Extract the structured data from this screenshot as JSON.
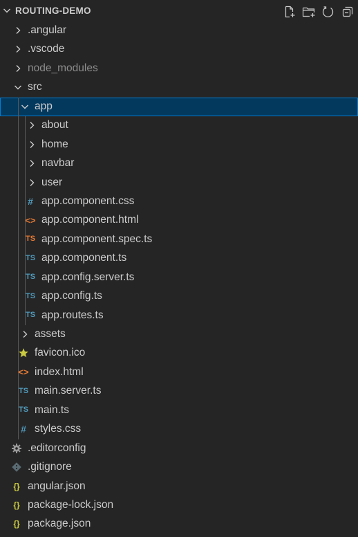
{
  "explorer": {
    "title": "ROUTING-DEMO",
    "actions": [
      {
        "name": "new-file",
        "icon": "new-file-icon"
      },
      {
        "name": "new-folder",
        "icon": "new-folder-icon"
      },
      {
        "name": "refresh",
        "icon": "refresh-icon"
      },
      {
        "name": "collapse-all",
        "icon": "collapse-all-icon"
      }
    ]
  },
  "tree": [
    {
      "label": ".angular",
      "depth": 0,
      "kind": "folder",
      "expanded": false
    },
    {
      "label": ".vscode",
      "depth": 0,
      "kind": "folder",
      "expanded": false
    },
    {
      "label": "node_modules",
      "depth": 0,
      "kind": "folder",
      "expanded": false,
      "dim": true
    },
    {
      "label": "src",
      "depth": 0,
      "kind": "folder",
      "expanded": true
    },
    {
      "label": "app",
      "depth": 1,
      "kind": "folder",
      "expanded": true,
      "selected": true
    },
    {
      "label": "about",
      "depth": 2,
      "kind": "folder",
      "expanded": false
    },
    {
      "label": "home",
      "depth": 2,
      "kind": "folder",
      "expanded": false
    },
    {
      "label": "navbar",
      "depth": 2,
      "kind": "folder",
      "expanded": false
    },
    {
      "label": "user",
      "depth": 2,
      "kind": "folder",
      "expanded": false
    },
    {
      "label": "app.component.css",
      "depth": 2,
      "kind": "file",
      "icon": "css"
    },
    {
      "label": "app.component.html",
      "depth": 2,
      "kind": "file",
      "icon": "html"
    },
    {
      "label": "app.component.spec.ts",
      "depth": 2,
      "kind": "file",
      "icon": "ts-spec"
    },
    {
      "label": "app.component.ts",
      "depth": 2,
      "kind": "file",
      "icon": "ts"
    },
    {
      "label": "app.config.server.ts",
      "depth": 2,
      "kind": "file",
      "icon": "ts"
    },
    {
      "label": "app.config.ts",
      "depth": 2,
      "kind": "file",
      "icon": "ts"
    },
    {
      "label": "app.routes.ts",
      "depth": 2,
      "kind": "file",
      "icon": "ts"
    },
    {
      "label": "assets",
      "depth": 1,
      "kind": "folder",
      "expanded": false
    },
    {
      "label": "favicon.ico",
      "depth": 1,
      "kind": "file",
      "icon": "star"
    },
    {
      "label": "index.html",
      "depth": 1,
      "kind": "file",
      "icon": "html"
    },
    {
      "label": "main.server.ts",
      "depth": 1,
      "kind": "file",
      "icon": "ts"
    },
    {
      "label": "main.ts",
      "depth": 1,
      "kind": "file",
      "icon": "ts"
    },
    {
      "label": "styles.css",
      "depth": 1,
      "kind": "file",
      "icon": "css"
    },
    {
      "label": ".editorconfig",
      "depth": 0,
      "kind": "file",
      "icon": "gear"
    },
    {
      "label": ".gitignore",
      "depth": 0,
      "kind": "file",
      "icon": "git"
    },
    {
      "label": "angular.json",
      "depth": 0,
      "kind": "file",
      "icon": "json"
    },
    {
      "label": "package-lock.json",
      "depth": 0,
      "kind": "file",
      "icon": "json"
    },
    {
      "label": "package.json",
      "depth": 0,
      "kind": "file",
      "icon": "json"
    }
  ],
  "colors": {
    "background": "#252526",
    "selected": "#04395e",
    "selectedBorder": "#007fd4",
    "css": "#519aba",
    "html": "#e37933",
    "ts": "#519aba",
    "tsSpec": "#e37933",
    "json": "#cbcb41",
    "star": "#cbcb41",
    "gear": "#9a9a9a",
    "git": "#41535b"
  }
}
